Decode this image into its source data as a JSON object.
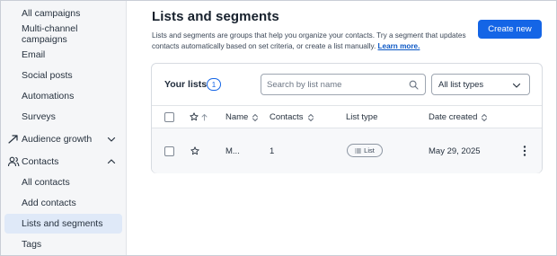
{
  "sidebar": {
    "items": [
      {
        "label": "All campaigns",
        "active": false
      },
      {
        "label": "Multi-channel campaigns",
        "active": false
      },
      {
        "label": "Email",
        "active": false
      },
      {
        "label": "Social posts",
        "active": false
      },
      {
        "label": "Automations",
        "active": false
      },
      {
        "label": "Surveys",
        "active": false
      },
      {
        "label": "Audience growth",
        "icon": "trend-up-icon",
        "chevron": "chevron-down-icon"
      },
      {
        "label": "Contacts",
        "icon": "people-icon",
        "chevron": "chevron-up-icon"
      },
      {
        "label": "All contacts",
        "active": false
      },
      {
        "label": "Add contacts",
        "active": false
      },
      {
        "label": "Lists and segments",
        "active": true
      },
      {
        "label": "Tags",
        "active": false
      }
    ]
  },
  "main": {
    "title": "Lists and segments",
    "description": "Lists and segments are groups that help you organize your contacts. Try a segment that updates contacts automatically based on set criteria, or create a list manually.",
    "learn_more": "Learn more.",
    "create_button": "Create new"
  },
  "lists_card": {
    "title": "Your lists",
    "count": "1",
    "search_placeholder": "Search by list name",
    "search_icon": "search-icon",
    "filter_value": "All list types",
    "columns": {
      "name": "Name",
      "contacts": "Contacts",
      "list_type": "List type",
      "date_created": "Date created"
    },
    "rows": [
      {
        "name": "M...",
        "contacts": "1",
        "list_type": "List",
        "date_created": "May 29, 2025"
      }
    ]
  },
  "colors": {
    "accent": "#1465e6",
    "sidebar_bg": "#f5f6f8",
    "active_bg": "#dfe9f8"
  }
}
